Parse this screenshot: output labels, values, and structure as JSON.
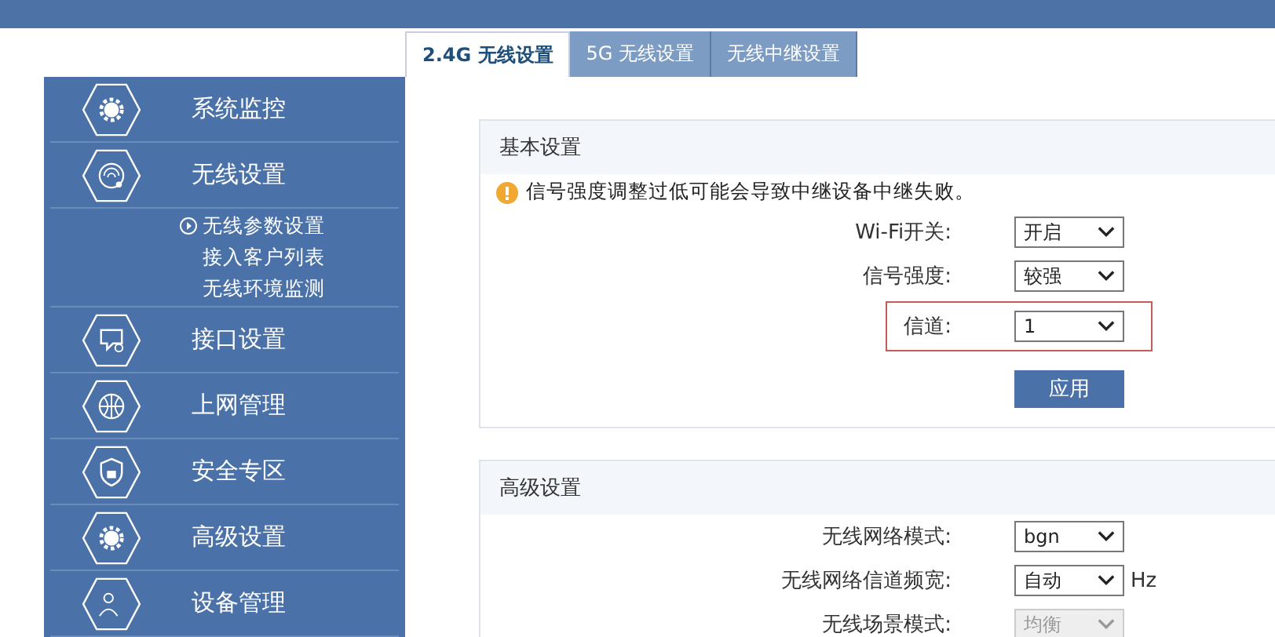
{
  "tabs": [
    {
      "label": "2.4G 无线设置",
      "selected": true
    },
    {
      "label": "5G 无线设置",
      "selected": false
    },
    {
      "label": "无线中继设置",
      "selected": false
    }
  ],
  "sidebar": {
    "items": [
      {
        "label": "系统监控"
      },
      {
        "label": "无线设置",
        "children": [
          {
            "label": "无线参数设置",
            "selected": true
          },
          {
            "label": "接入客户列表",
            "selected": false
          },
          {
            "label": "无线环境监测",
            "selected": false
          }
        ]
      },
      {
        "label": "接口设置"
      },
      {
        "label": "上网管理"
      },
      {
        "label": "安全专区"
      },
      {
        "label": "高级设置"
      },
      {
        "label": "设备管理"
      }
    ]
  },
  "sections": [
    {
      "title": "基本设置",
      "warning": "信号强度调整过低可能会导致中继设备中继失败。",
      "fields": [
        {
          "label": "Wi-Fi开关:",
          "value": "开启",
          "disabled": false,
          "highlighted": false
        },
        {
          "label": "信号强度:",
          "value": "较强",
          "disabled": false,
          "highlighted": false
        },
        {
          "label": "信道:",
          "value": "1",
          "disabled": false,
          "highlighted": true
        }
      ],
      "button": "应用"
    },
    {
      "title": "高级设置",
      "fields": [
        {
          "label": "无线网络模式:",
          "value": "bgn",
          "disabled": false,
          "highlighted": false
        },
        {
          "label": "无线网络信道频宽:",
          "value": "自动",
          "disabled": false,
          "highlighted": false,
          "suffix": "Hz"
        },
        {
          "label": "无线场景模式:",
          "value": "均衡",
          "disabled": true,
          "highlighted": false
        }
      ]
    }
  ]
}
